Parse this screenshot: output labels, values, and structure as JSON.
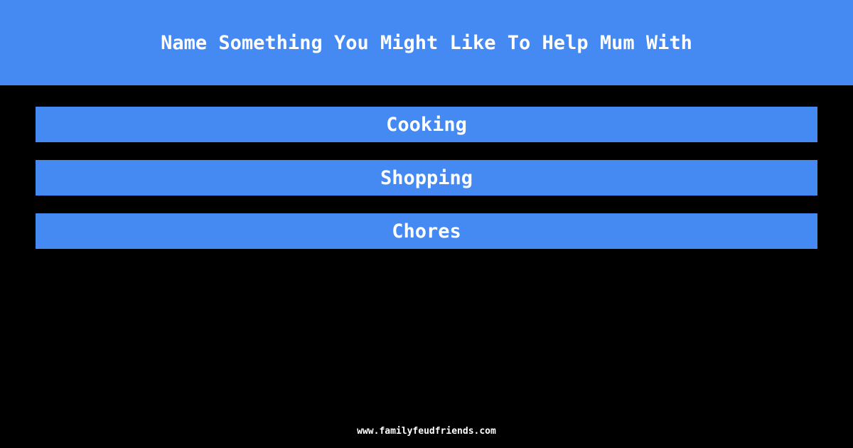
{
  "question": {
    "title": "Name Something You Might Like To Help Mum With"
  },
  "answers": [
    {
      "label": "Cooking"
    },
    {
      "label": "Shopping"
    },
    {
      "label": "Chores"
    }
  ],
  "footer": {
    "site": "www.familyfeudfriends.com"
  },
  "colors": {
    "accent": "#4589f3",
    "background": "#000000",
    "text": "#ffffff"
  }
}
